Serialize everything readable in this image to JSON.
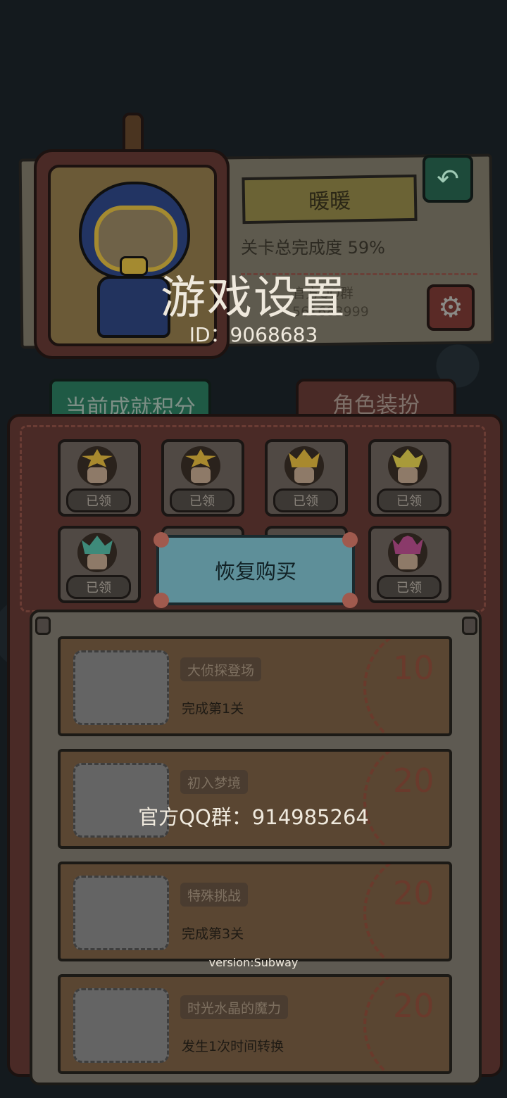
{
  "profile": {
    "name": "暖暖",
    "progress": "关卡总完成度 59%",
    "qq_line1": "官方QQ群",
    "qq_line2": "561683999"
  },
  "overlay": {
    "title": "游戏设置",
    "player_id": "ID：9068683",
    "restore_button": "恢复购买",
    "official_qq": "官方QQ群：914985264",
    "version": "version:Subway"
  },
  "tabs": {
    "achievement": "当前成就积分",
    "dress": "角色装扮"
  },
  "rewards": [
    {
      "status": "已领",
      "crown_color": "#a8892e"
    },
    {
      "status": "已领",
      "crown_color": "#a8892e"
    },
    {
      "status": "已领",
      "crown_color": "#a8892e"
    },
    {
      "status": "已领",
      "crown_color": "#a89a3a"
    },
    {
      "status": "已领",
      "crown_color": "#3e8a7a"
    },
    {
      "status": "已领",
      "crown_color": "#8a3a6a"
    }
  ],
  "achievements": [
    {
      "title": "大侦探登场",
      "desc": "完成第1关",
      "points": "10"
    },
    {
      "title": "初入梦境",
      "desc": "",
      "points": "20"
    },
    {
      "title": "特殊挑战",
      "desc": "完成第3关",
      "points": "20"
    },
    {
      "title": "时光水晶的魔力",
      "desc": "发生1次时间转换",
      "points": "20"
    }
  ],
  "icons": {
    "back": "undo-arrow-icon",
    "settings": "gear-icon"
  }
}
